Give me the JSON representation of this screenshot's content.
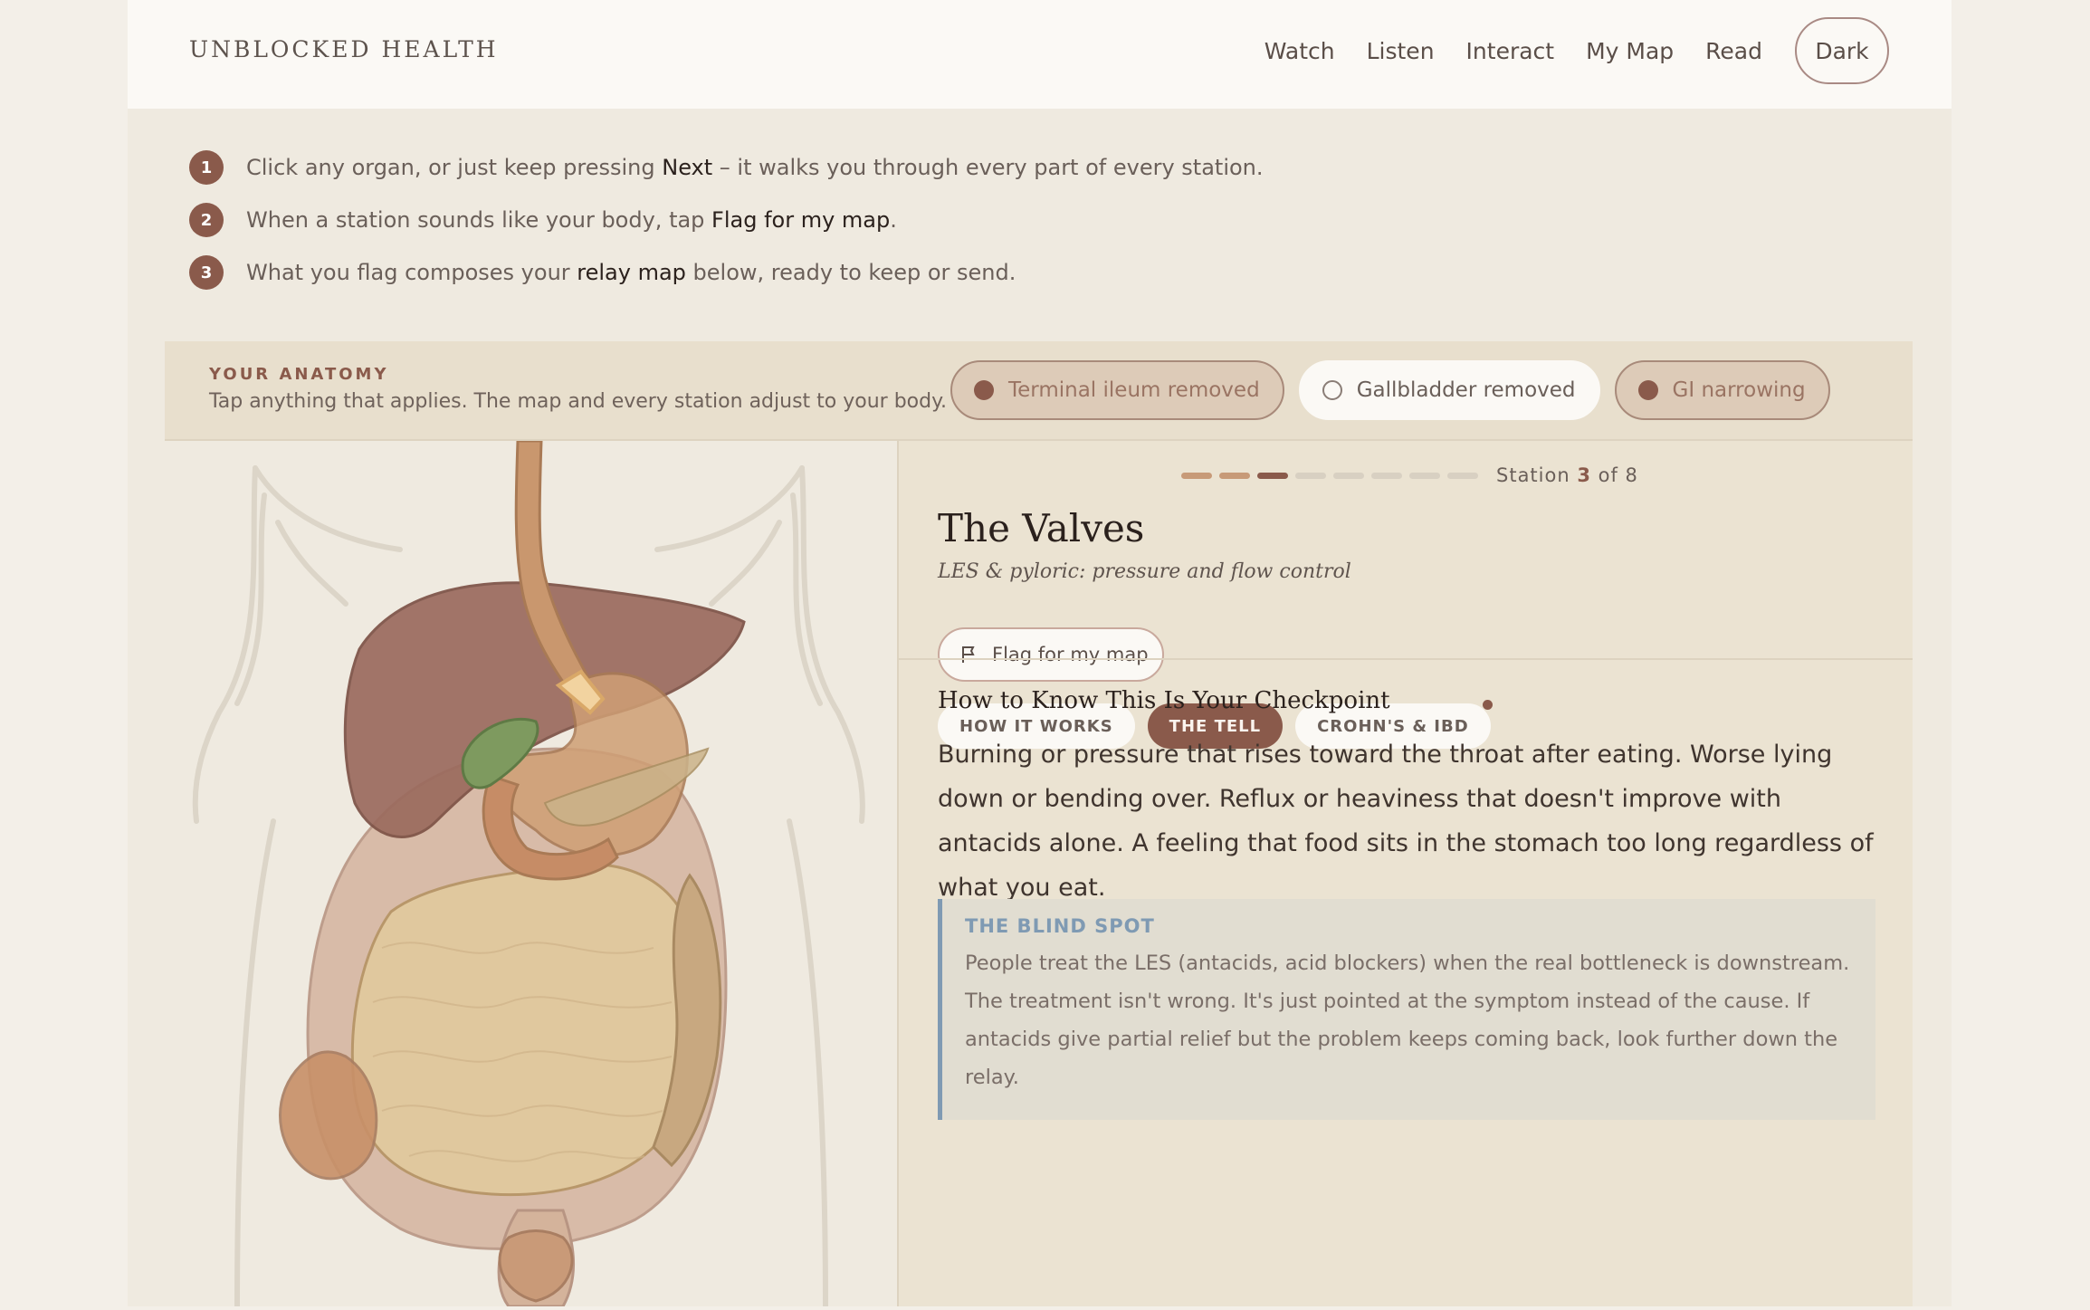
{
  "header": {
    "brand": "UNBLOCKED HEALTH",
    "nav": [
      "Watch",
      "Listen",
      "Interact",
      "My Map",
      "Read"
    ],
    "theme_button": "Dark"
  },
  "steps": [
    {
      "num": "1",
      "pre": "Click any organ, or just keep pressing ",
      "bold": "Next",
      "post": " – it walks you through every part of every station."
    },
    {
      "num": "2",
      "pre": "When a station sounds like your body, tap ",
      "bold": "Flag for my map",
      "post": "."
    },
    {
      "num": "3",
      "pre": "What you flag composes your ",
      "bold": "relay map",
      "post": " below, ready to keep or send."
    }
  ],
  "anatomy": {
    "label": "YOUR ANATOMY",
    "sub": "Tap anything that applies. The map and every station adjust to your body.",
    "chips": [
      {
        "label": "Terminal ileum removed",
        "selected": true
      },
      {
        "label": "Gallbladder removed",
        "selected": false
      },
      {
        "label": "GI narrowing",
        "selected": true
      }
    ]
  },
  "station": {
    "progress_current": 3,
    "progress_total": 8,
    "label_pre": "Station ",
    "current": "3",
    "label_post": " of 8",
    "title": "The Valves",
    "subtitle": "LES & pyloric: pressure and flow control",
    "flag_button": "Flag for my map",
    "tabs": [
      {
        "label": "HOW IT WORKS",
        "active": false,
        "notif": false
      },
      {
        "label": "THE TELL",
        "active": true,
        "notif": false
      },
      {
        "label": "CROHN'S & IBD",
        "active": false,
        "notif": true
      }
    ],
    "section_heading": "How to Know This Is Your Checkpoint",
    "body": "Burning or pressure that rises toward the throat after eating. Worse lying down or bending over. Reflux or heaviness that doesn't improve with antacids alone. A feeling that food sits in the stomach too long regardless of what you eat.",
    "blind_spot": {
      "heading": "THE BLIND SPOT",
      "text": "People treat the LES (antacids, acid blockers) when the real bottleneck is downstream. The treatment isn't wrong. It's just pointed at the symptom instead of the cause. If antacids give partial relief but the problem keeps coming back, look further down the relay."
    }
  },
  "colors": {
    "accent": "#8a5a4b",
    "blind_spot_accent": "#7f9ab3",
    "page_bg": "#efeae0",
    "card_bg": "#ebe3d2"
  }
}
